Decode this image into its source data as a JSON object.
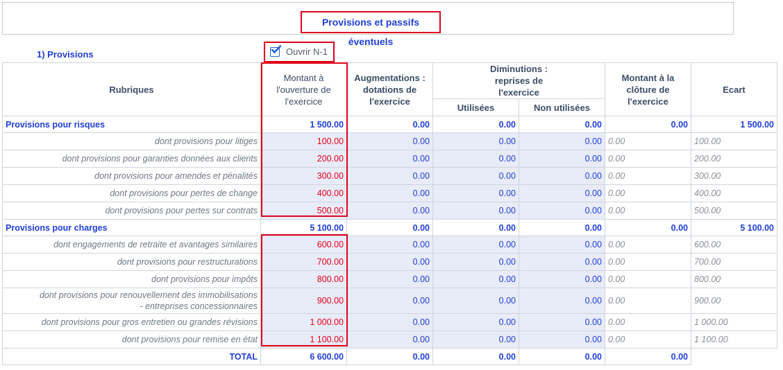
{
  "title": "Provisions et passifs éventuels",
  "section_label": "1) Provisions",
  "checkbox": {
    "label": "Ouvrir N-1",
    "checked": true
  },
  "headers": {
    "rubriques": "Rubriques",
    "ouverture": "Montant à l'ouverture de l'exercice",
    "augmentations": "Augmentations : dotations de l'exercice",
    "diminutions": "Diminutions : reprises de l'exercice",
    "utilisees": "Utilisées",
    "non_utilisees": "Non utilisées",
    "cloture": "Montant à la clôture de l'exercice",
    "ecart": "Ecart"
  },
  "rows": [
    {
      "kind": "category",
      "label": "Provisions pour risques",
      "ouverture": "1 500.00",
      "augmentations": "0.00",
      "utilisees": "0.00",
      "non_utilisees": "0.00",
      "cloture": "0.00",
      "ecart": "1 500.00"
    },
    {
      "kind": "sub",
      "label": "dont provisions pour litiges",
      "ouverture": "100.00",
      "augmentations": "0.00",
      "utilisees": "0.00",
      "non_utilisees": "0.00",
      "cloture": "0.00",
      "ecart": "100.00"
    },
    {
      "kind": "sub",
      "label": "dont provisions pour garanties données aux clients",
      "ouverture": "200.00",
      "augmentations": "0.00",
      "utilisees": "0.00",
      "non_utilisees": "0.00",
      "cloture": "0.00",
      "ecart": "200.00"
    },
    {
      "kind": "sub",
      "label": "dont provisions pour amendes et pénalités",
      "ouverture": "300.00",
      "augmentations": "0.00",
      "utilisees": "0.00",
      "non_utilisees": "0.00",
      "cloture": "0.00",
      "ecart": "300.00"
    },
    {
      "kind": "sub",
      "label": "dont provisions pour pertes de change",
      "ouverture": "400.00",
      "augmentations": "0.00",
      "utilisees": "0.00",
      "non_utilisees": "0.00",
      "cloture": "0.00",
      "ecart": "400.00"
    },
    {
      "kind": "sub",
      "label": "dont provisions pour pertes sur contrats",
      "ouverture": "500.00",
      "augmentations": "0.00",
      "utilisees": "0.00",
      "non_utilisees": "0.00",
      "cloture": "0.00",
      "ecart": "500.00"
    },
    {
      "kind": "category",
      "label": "Provisions pour charges",
      "ouverture": "5 100.00",
      "augmentations": "0.00",
      "utilisees": "0.00",
      "non_utilisees": "0.00",
      "cloture": "0.00",
      "ecart": "5 100.00"
    },
    {
      "kind": "sub",
      "label": "dont engagements de retraite et avantages similaires",
      "ouverture": "600.00",
      "augmentations": "0.00",
      "utilisees": "0.00",
      "non_utilisees": "0.00",
      "cloture": "0.00",
      "ecart": "600.00"
    },
    {
      "kind": "sub",
      "label": "dont provisions pour restructurations",
      "ouverture": "700.00",
      "augmentations": "0.00",
      "utilisees": "0.00",
      "non_utilisees": "0.00",
      "cloture": "0.00",
      "ecart": "700.00"
    },
    {
      "kind": "sub",
      "label": "dont provisions pour impôts",
      "ouverture": "800.00",
      "augmentations": "0.00",
      "utilisees": "0.00",
      "non_utilisees": "0.00",
      "cloture": "0.00",
      "ecart": "800.00"
    },
    {
      "kind": "sub2",
      "label": "dont provisions pour renouvellement des immobilisations",
      "label2": "- entreprises concessionnaires",
      "ouverture": "900.00",
      "augmentations": "0.00",
      "utilisees": "0.00",
      "non_utilisees": "0.00",
      "cloture": "0.00",
      "ecart": "900.00"
    },
    {
      "kind": "sub",
      "label": "dont provisions pour gros entretien ou grandes révisions",
      "ouverture": "1 000.00",
      "augmentations": "0.00",
      "utilisees": "0.00",
      "non_utilisees": "0.00",
      "cloture": "0.00",
      "ecart": "1 000.00"
    },
    {
      "kind": "sub",
      "label": "dont provisions pour remise en état",
      "ouverture": "1 100.00",
      "augmentations": "0.00",
      "utilisees": "0.00",
      "non_utilisees": "0.00",
      "cloture": "0.00",
      "ecart": "1 100.00"
    }
  ],
  "total": {
    "label": "TOTAL",
    "ouverture": "6 600.00",
    "augmentations": "0.00",
    "utilisees": "0.00",
    "non_utilisees": "0.00",
    "cloture": "0.00"
  }
}
